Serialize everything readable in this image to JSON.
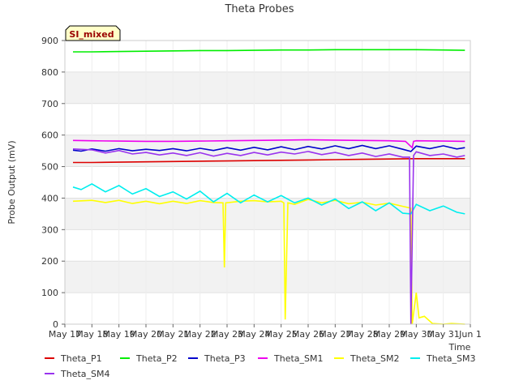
{
  "chart_data": {
    "type": "line",
    "title": "Theta Probes",
    "site_label": "SI_mixed",
    "xlabel": "Time",
    "ylabel": "Probe Output (mV)",
    "ylim": [
      0,
      900
    ],
    "yticks": [
      0,
      100,
      200,
      300,
      400,
      500,
      600,
      700,
      800,
      900
    ],
    "xlim": [
      0,
      15
    ],
    "xticks": [
      0,
      1,
      2,
      3,
      4,
      5,
      6,
      7,
      8,
      9,
      10,
      11,
      12,
      13,
      14,
      15
    ],
    "xtick_labels": [
      "May 17",
      "May 18",
      "May 19",
      "May 20",
      "May 21",
      "May 22",
      "May 23",
      "May 24",
      "May 25",
      "May 26",
      "May 27",
      "May 28",
      "May 29",
      "May 30",
      "May 31",
      "Jun 1"
    ],
    "grid": true,
    "legend_position": "bottom",
    "series": [
      {
        "name": "Theta_P1",
        "color": "#dd0000",
        "points": [
          [
            0.3,
            513
          ],
          [
            1,
            513
          ],
          [
            2,
            514
          ],
          [
            3,
            515
          ],
          [
            4,
            516
          ],
          [
            5,
            517
          ],
          [
            6,
            518
          ],
          [
            7,
            519
          ],
          [
            8,
            520
          ],
          [
            9,
            521
          ],
          [
            10,
            522
          ],
          [
            11,
            523
          ],
          [
            12,
            524
          ],
          [
            13,
            525
          ],
          [
            14,
            525
          ],
          [
            14.8,
            525
          ]
        ]
      },
      {
        "name": "Theta_P2",
        "color": "#00ee00",
        "points": [
          [
            0.3,
            864
          ],
          [
            1,
            864
          ],
          [
            2,
            865
          ],
          [
            3,
            866
          ],
          [
            4,
            867
          ],
          [
            5,
            868
          ],
          [
            6,
            868
          ],
          [
            7,
            869
          ],
          [
            8,
            870
          ],
          [
            9,
            870
          ],
          [
            10,
            871
          ],
          [
            11,
            871
          ],
          [
            12,
            871
          ],
          [
            13,
            871
          ],
          [
            14,
            870
          ],
          [
            14.8,
            869
          ]
        ]
      },
      {
        "name": "Theta_P3",
        "color": "#0000cc",
        "points": [
          [
            0.3,
            552
          ],
          [
            0.6,
            549
          ],
          [
            1,
            556
          ],
          [
            1.5,
            549
          ],
          [
            2,
            557
          ],
          [
            2.5,
            550
          ],
          [
            3,
            555
          ],
          [
            3.5,
            551
          ],
          [
            4,
            557
          ],
          [
            4.5,
            550
          ],
          [
            5,
            558
          ],
          [
            5.5,
            551
          ],
          [
            6,
            560
          ],
          [
            6.5,
            552
          ],
          [
            7,
            561
          ],
          [
            7.5,
            553
          ],
          [
            8,
            563
          ],
          [
            8.5,
            554
          ],
          [
            9,
            564
          ],
          [
            9.5,
            556
          ],
          [
            10,
            566
          ],
          [
            10.5,
            557
          ],
          [
            11,
            567
          ],
          [
            11.5,
            557
          ],
          [
            12,
            566
          ],
          [
            12.5,
            555
          ],
          [
            12.8,
            548
          ],
          [
            13,
            565
          ],
          [
            13.5,
            557
          ],
          [
            14,
            566
          ],
          [
            14.5,
            556
          ],
          [
            14.8,
            560
          ]
        ]
      },
      {
        "name": "Theta_SM1",
        "color": "#ee00ee",
        "points": [
          [
            0.3,
            583
          ],
          [
            1,
            582
          ],
          [
            2,
            581
          ],
          [
            3,
            580
          ],
          [
            4,
            580
          ],
          [
            5,
            581
          ],
          [
            6,
            582
          ],
          [
            7,
            583
          ],
          [
            8,
            584
          ],
          [
            9,
            585
          ],
          [
            10,
            584
          ],
          [
            11,
            583
          ],
          [
            12,
            582
          ],
          [
            12.6,
            580
          ],
          [
            12.85,
            560
          ],
          [
            12.9,
            580
          ],
          [
            13,
            582
          ],
          [
            14,
            581
          ],
          [
            14.8,
            580
          ]
        ]
      },
      {
        "name": "Theta_SM2",
        "color": "#ffff00",
        "points": [
          [
            0.3,
            390
          ],
          [
            1,
            393
          ],
          [
            1.5,
            386
          ],
          [
            2,
            393
          ],
          [
            2.5,
            383
          ],
          [
            3,
            390
          ],
          [
            3.5,
            382
          ],
          [
            4,
            390
          ],
          [
            4.5,
            383
          ],
          [
            5,
            392
          ],
          [
            5.5,
            386
          ],
          [
            5.85,
            385
          ],
          [
            5.9,
            180
          ],
          [
            5.95,
            385
          ],
          [
            6.5,
            390
          ],
          [
            7,
            392
          ],
          [
            7.5,
            388
          ],
          [
            8,
            390
          ],
          [
            8.1,
            385
          ],
          [
            8.15,
            15
          ],
          [
            8.25,
            385
          ],
          [
            8.5,
            380
          ],
          [
            9,
            396
          ],
          [
            9.5,
            385
          ],
          [
            10,
            393
          ],
          [
            10.5,
            382
          ],
          [
            11,
            387
          ],
          [
            11.5,
            378
          ],
          [
            12,
            384
          ],
          [
            12.5,
            374
          ],
          [
            12.8,
            368
          ],
          [
            12.85,
            0
          ],
          [
            13,
            100
          ],
          [
            13.1,
            20
          ],
          [
            13.3,
            25
          ],
          [
            13.6,
            2
          ],
          [
            14,
            0
          ],
          [
            14.3,
            2
          ],
          [
            14.8,
            0
          ]
        ]
      },
      {
        "name": "Theta_SM3",
        "color": "#00eeee",
        "points": [
          [
            0.3,
            435
          ],
          [
            0.6,
            427
          ],
          [
            1,
            445
          ],
          [
            1.5,
            420
          ],
          [
            2,
            440
          ],
          [
            2.5,
            413
          ],
          [
            3,
            430
          ],
          [
            3.5,
            405
          ],
          [
            4,
            420
          ],
          [
            4.5,
            397
          ],
          [
            5,
            422
          ],
          [
            5.5,
            388
          ],
          [
            6,
            415
          ],
          [
            6.5,
            385
          ],
          [
            7,
            410
          ],
          [
            7.5,
            388
          ],
          [
            8,
            408
          ],
          [
            8.5,
            385
          ],
          [
            9,
            400
          ],
          [
            9.5,
            378
          ],
          [
            10,
            397
          ],
          [
            10.5,
            367
          ],
          [
            11,
            388
          ],
          [
            11.5,
            360
          ],
          [
            12,
            385
          ],
          [
            12.5,
            352
          ],
          [
            12.8,
            350
          ],
          [
            13,
            380
          ],
          [
            13.5,
            360
          ],
          [
            14,
            375
          ],
          [
            14.5,
            355
          ],
          [
            14.8,
            350
          ]
        ]
      },
      {
        "name": "Theta_SM4",
        "color": "#9933ee",
        "points": [
          [
            0.3,
            556
          ],
          [
            1,
            553
          ],
          [
            1.5,
            543
          ],
          [
            2,
            551
          ],
          [
            2.5,
            540
          ],
          [
            3,
            545
          ],
          [
            3.5,
            537
          ],
          [
            4,
            543
          ],
          [
            4.5,
            535
          ],
          [
            5,
            544
          ],
          [
            5.5,
            533
          ],
          [
            6,
            542
          ],
          [
            6.5,
            535
          ],
          [
            7,
            545
          ],
          [
            7.5,
            537
          ],
          [
            8,
            546
          ],
          [
            8.5,
            540
          ],
          [
            9,
            548
          ],
          [
            9.5,
            538
          ],
          [
            10,
            545
          ],
          [
            10.5,
            535
          ],
          [
            11,
            543
          ],
          [
            11.5,
            532
          ],
          [
            12,
            540
          ],
          [
            12.5,
            530
          ],
          [
            12.75,
            530
          ],
          [
            12.8,
            0
          ],
          [
            12.9,
            535
          ],
          [
            13,
            547
          ],
          [
            13.5,
            535
          ],
          [
            14,
            540
          ],
          [
            14.5,
            530
          ],
          [
            14.8,
            535
          ]
        ]
      }
    ]
  }
}
